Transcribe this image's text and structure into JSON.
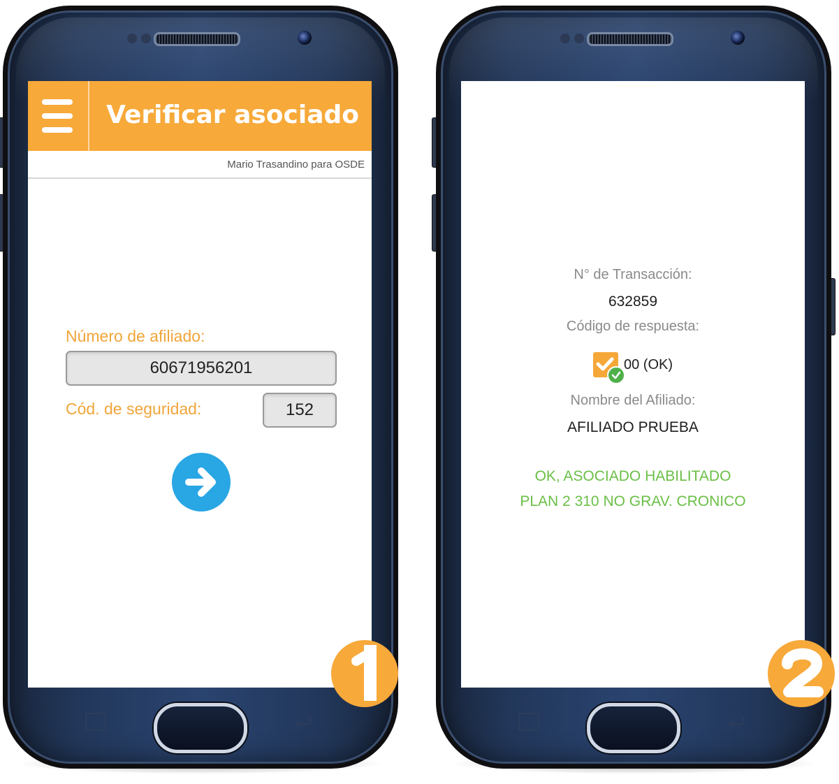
{
  "screen1": {
    "title": "Verificar asociado",
    "subtitle": "Mario Trasandino para OSDE",
    "affiliate_label": "Número de afiliado:",
    "affiliate_value": "60671956201",
    "security_label": "Cód. de seguridad:",
    "security_value": "152",
    "step_number": "1"
  },
  "screen2": {
    "transaction_label": "N° de Transacción:",
    "transaction_value": "632859",
    "response_label": "Código de respuesta:",
    "response_value": "00 (OK)",
    "name_label": "Nombre del Afiliado:",
    "name_value": "AFILIADO PRUEBA",
    "status_line1": "OK, ASOCIADO HABILITADO",
    "status_line2": "PLAN 2 310 NO GRAV. CRONICO",
    "step_number": "2"
  },
  "colors": {
    "accent_orange": "#f7a93a",
    "label_orange": "#f0a53a",
    "go_blue": "#29a6e4",
    "status_green": "#6abf46"
  },
  "icons": [
    "hamburger-menu-icon",
    "arrow-right-icon",
    "checkmark-icon",
    "check-badge-icon",
    "recent-apps-icon",
    "back-icon"
  ]
}
